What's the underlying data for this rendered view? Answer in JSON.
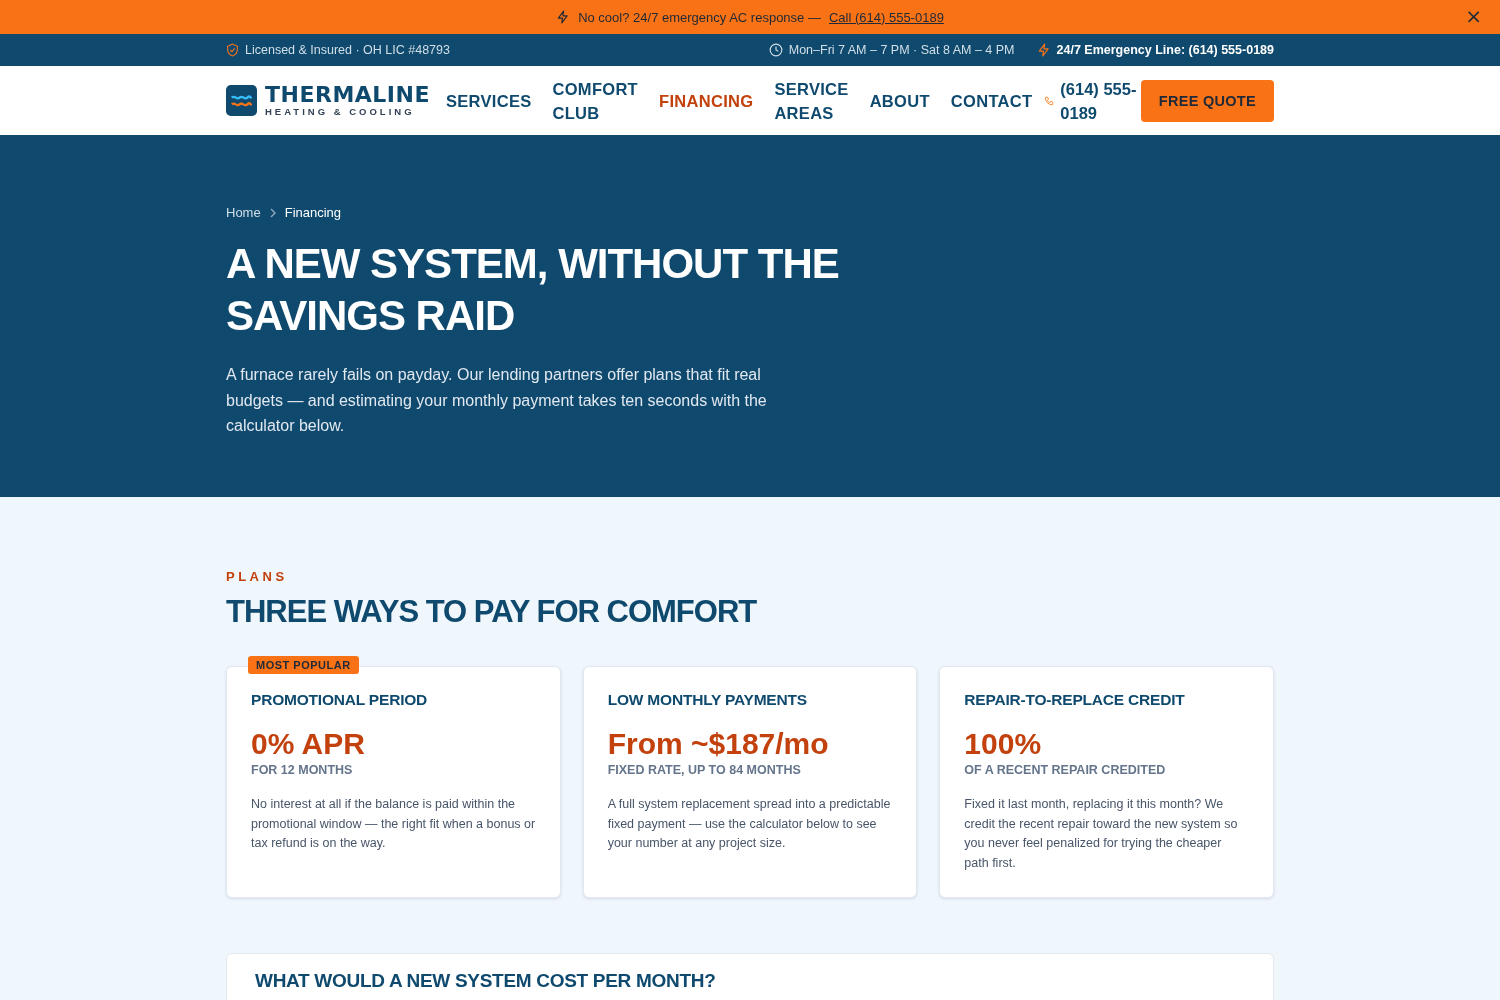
{
  "announcement": {
    "text": "No cool? 24/7 emergency AC response —",
    "link": "Call (614) 555-0189",
    "close": "×"
  },
  "topbar": {
    "license": "Licensed & Insured · OH LIC #48793",
    "hours": "Mon–Fri 7 AM – 7 PM · Sat 8 AM – 4 PM",
    "emergency": "24/7 Emergency Line: (614) 555-0189"
  },
  "header": {
    "brand": "THERMALINE",
    "tagline": "HEATING & COOLING",
    "nav": [
      {
        "label": "SERVICES",
        "selected": false
      },
      {
        "label": "COMFORT CLUB",
        "selected": false
      },
      {
        "label": "FINANCING",
        "selected": true
      },
      {
        "label": "SERVICE AREAS",
        "selected": false
      },
      {
        "label": "ABOUT",
        "selected": false
      },
      {
        "label": "CONTACT",
        "selected": false
      }
    ],
    "phone": "(614) 555-0189",
    "cta": "FREE QUOTE"
  },
  "hero": {
    "breadcrumb": [
      "Home",
      "Financing"
    ],
    "title": "A NEW SYSTEM, WITHOUT THE SAVINGS RAID",
    "lead": "A furnace rarely fails on payday. Our lending partners offer plans that fit real budgets — and estimating your monthly payment takes ten seconds with the calculator below."
  },
  "plans": {
    "eyebrow": "PLANS",
    "title": "THREE WAYS TO PAY FOR COMFORT",
    "cards": [
      {
        "badge": "MOST POPULAR",
        "title": "PROMOTIONAL PERIOD",
        "figure": "0% APR",
        "sub": "FOR 12 MONTHS",
        "text": "No interest at all if the balance is paid within the promotional window — the right fit when a bonus or tax refund is on the way."
      },
      {
        "title": "LOW MONTHLY PAYMENTS",
        "figure": "From ~$187/mo",
        "sub": "FIXED RATE, UP TO 84 MONTHS",
        "text": "A full system replacement spread into a predictable fixed payment — use the calculator below to see your number at any project size."
      },
      {
        "title": "REPAIR-TO-REPLACE CREDIT",
        "figure": "100%",
        "sub": "OF A RECENT REPAIR CREDITED",
        "text": "Fixed it last month, replacing it this month? We credit the recent repair toward the new system so you never feel penalized for trying the cheaper path first."
      }
    ]
  },
  "calculator": {
    "title": "WHAT WOULD A NEW SYSTEM COST PER MONTH?"
  }
}
